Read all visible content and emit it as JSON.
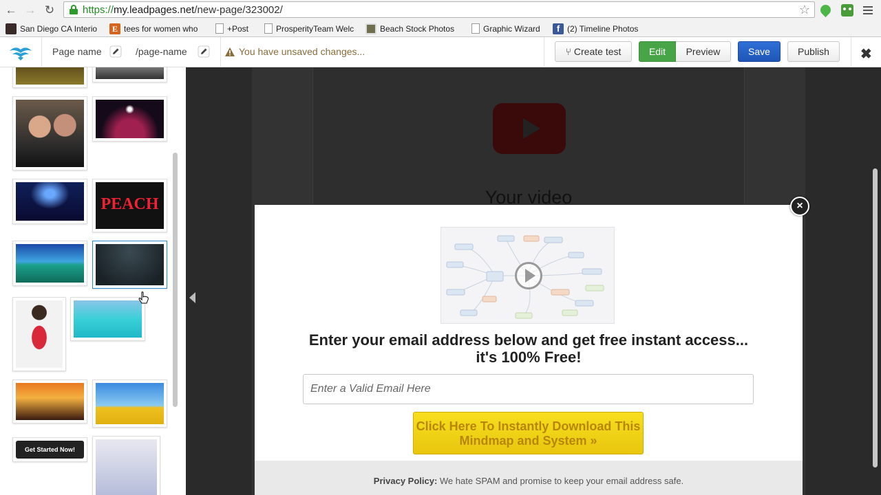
{
  "browser": {
    "url_scheme": "https://",
    "url_host": "my.leadpages.net",
    "url_path": "/new-page/323002/"
  },
  "bookmarks": [
    {
      "label": "San Diego CA Interio",
      "icon": "dark-favicon"
    },
    {
      "label": "tees for women who",
      "icon": "etsy-favicon"
    },
    {
      "label": "+Post",
      "icon": "page-icon"
    },
    {
      "label": "ProsperityTeam Welc",
      "icon": "page-icon"
    },
    {
      "label": "Beach Stock Photos",
      "icon": "photo-favicon"
    },
    {
      "label": "Graphic Wizard",
      "icon": "page-icon"
    },
    {
      "label": "(2) Timeline Photos",
      "icon": "facebook-favicon"
    }
  ],
  "header": {
    "page_name": "Page name",
    "page_slug": "/page-name",
    "warning": "You have unsaved changes...",
    "create_test": "Create test",
    "create_test_glyph": "⑂",
    "edit": "Edit",
    "preview": "Preview",
    "save": "Save",
    "publish": "Publish",
    "close_glyph": "✖"
  },
  "sidebar": {
    "thumb_label_get_started": "Get Started Now!",
    "thumb_label_peach": "PEACH"
  },
  "canvas": {
    "video_title": "Your video"
  },
  "modal": {
    "close_glyph": "×",
    "headline_line1": "Enter your email address below and get free instant access...",
    "headline_line2": "it's 100% Free!",
    "email_placeholder": "Enter a Valid Email Here",
    "cta_line1": "Click Here To Instantly Download This",
    "cta_line2": "Mindmap and System »",
    "privacy_label": "Privacy Policy:",
    "privacy_text": " We hate SPAM and promise to keep your email address safe."
  },
  "colors": {
    "edit_green": "#47a447",
    "save_blue": "#1f56b6",
    "cta_yellow": "#f7df1e",
    "canvas_dark": "#2a2a2a"
  }
}
